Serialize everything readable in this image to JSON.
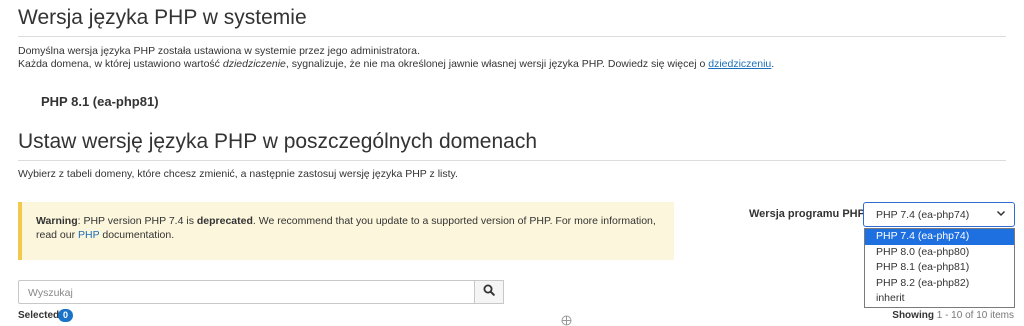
{
  "section1": {
    "title": "Wersja języka PHP w systemie",
    "line1": "Domyślna wersja języka PHP została ustawiona w systemie przez jego administratora.",
    "line2_before": "Każda domena, w której ustawiono wartość ",
    "line2_em": "dziedziczenie",
    "line2_after": ", sygnalizuje, że nie ma określonej jawnie własnej wersji języka PHP. Dowiedz się więcej o ",
    "line2_link": "dziedziczeniu",
    "line2_end": ".",
    "current_version": "PHP 8.1 (ea-php81)"
  },
  "section2": {
    "title": "Ustaw wersję języka PHP w poszczególnych domenach",
    "instructions": "Wybierz z tabeli domeny, które chcesz zmienić, a następnie zastosuj wersję języka PHP z listy."
  },
  "warning": {
    "label": "Warning",
    "text1": ": PHP version PHP 7.4 is ",
    "bold": "deprecated",
    "text2": ". We recommend that you update to a supported version of PHP. For more information, read our ",
    "link": "PHP",
    "text3": " documentation."
  },
  "php_select": {
    "label": "Wersja programu PHP",
    "value": "PHP 7.4 (ea-php74)",
    "options": [
      "PHP 7.4 (ea-php74)",
      "PHP 8.0 (ea-php80)",
      "PHP 8.1 (ea-php81)",
      "PHP 8.2 (ea-php82)",
      "inherit"
    ],
    "selected_index": 0
  },
  "search": {
    "placeholder": "Wyszukaj"
  },
  "selection": {
    "label": "Selected",
    "count": "0"
  },
  "pagination": {
    "showing_label": "Showing",
    "range_text": " 1 - 10 of 10 items"
  },
  "colors": {
    "accent": "#1e6fe0",
    "warning_bg": "#fcf6dc",
    "warning_border": "#f2c94c",
    "link": "#1c6fb8"
  }
}
